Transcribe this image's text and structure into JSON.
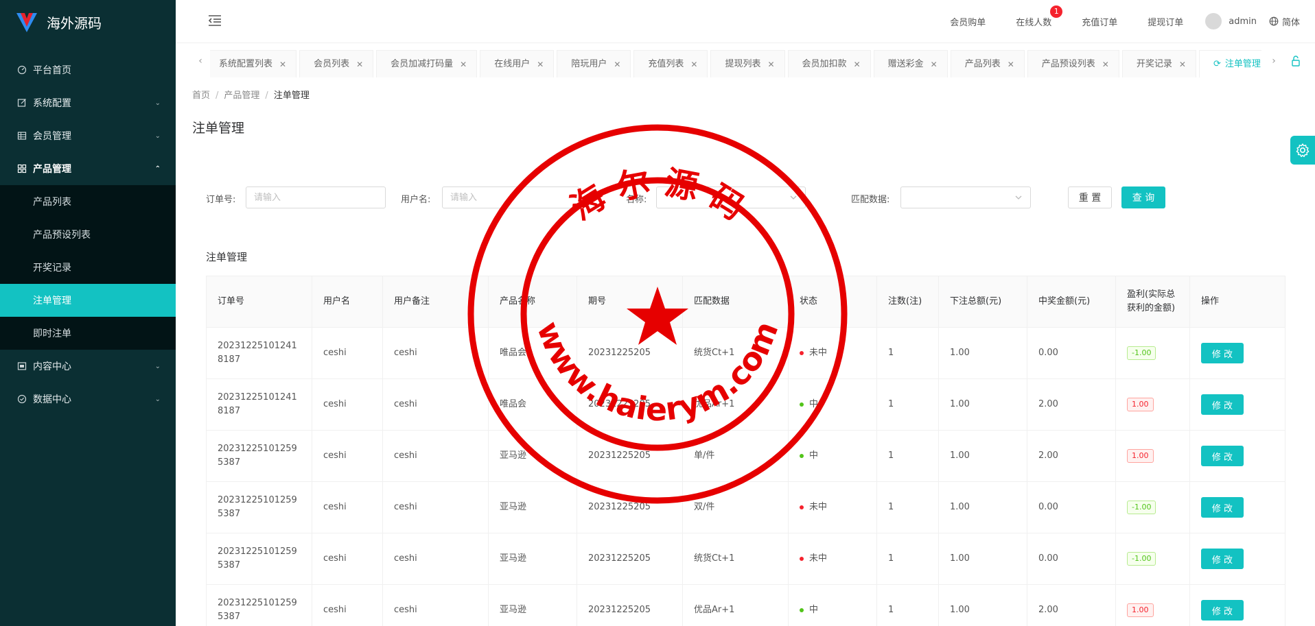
{
  "brand": {
    "name": "海外源码",
    "logo": "v-logo"
  },
  "menu": {
    "items": [
      {
        "label": "平台首页",
        "icon": "dashboard-icon"
      },
      {
        "label": "系统配置",
        "icon": "edit-icon"
      },
      {
        "label": "会员管理",
        "icon": "table-icon"
      },
      {
        "label": "产品管理",
        "icon": "grid-icon"
      },
      {
        "label": "内容中心",
        "icon": "content-icon"
      },
      {
        "label": "数据中心",
        "icon": "check-circle-icon"
      }
    ],
    "sub": [
      {
        "label": "产品列表"
      },
      {
        "label": "产品预设列表"
      },
      {
        "label": "开奖记录"
      },
      {
        "label": "注单管理"
      },
      {
        "label": "即时注单"
      }
    ]
  },
  "header": {
    "links": [
      {
        "label": "会员购单"
      },
      {
        "label": "在线人数",
        "badge": "1"
      },
      {
        "label": "充值订单"
      },
      {
        "label": "提现订单"
      }
    ],
    "user": "admin",
    "lang": "简体"
  },
  "tabs": [
    {
      "label": "系统配置列表"
    },
    {
      "label": "会员列表"
    },
    {
      "label": "会员加减打码量"
    },
    {
      "label": "在线用户"
    },
    {
      "label": "陪玩用户"
    },
    {
      "label": "充值列表"
    },
    {
      "label": "提现列表"
    },
    {
      "label": "会员加扣款"
    },
    {
      "label": "赠送彩金"
    },
    {
      "label": "产品列表"
    },
    {
      "label": "产品预设列表"
    },
    {
      "label": "开奖记录"
    },
    {
      "label": "注单管理"
    }
  ],
  "breadcrumb": {
    "home": "首页",
    "parent": "产品管理",
    "current": "注单管理"
  },
  "page_title": "注单管理",
  "filters": {
    "order_label": "订单号:",
    "order_placeholder": "请输入",
    "user_label": "用户名:",
    "user_placeholder": "请输入",
    "name_label": "名称:",
    "match_label": "匹配数据:",
    "reset": "重 置",
    "query": "查 询"
  },
  "table_title": "注单管理",
  "columns": [
    "订单号",
    "用户名",
    "用户备注",
    "产品名称",
    "期号",
    "匹配数据",
    "状态",
    "注数(注)",
    "下注总额(元)",
    "中奖金额(元)",
    "盈利(实际总获利的金额)",
    "操作"
  ],
  "rows": [
    {
      "order": "202312251012418187",
      "user": "ceshi",
      "remark": "ceshi",
      "product": "唯品会",
      "period": "20231225205",
      "match": "统货Ct+1",
      "status": "未中",
      "status_color": "#f5222d",
      "count": "1",
      "total": "1.00",
      "win": "0.00",
      "profit": "-1.00",
      "profit_type": "loss",
      "action": "修 改"
    },
    {
      "order": "202312251012418187",
      "user": "ceshi",
      "remark": "ceshi",
      "product": "唯品会",
      "period": "20231225205",
      "match": "优品Ar+1",
      "status": "中",
      "status_color": "#52c41a",
      "count": "1",
      "total": "1.00",
      "win": "2.00",
      "profit": "1.00",
      "profit_type": "win",
      "action": "修 改"
    },
    {
      "order": "202312251012595387",
      "user": "ceshi",
      "remark": "ceshi",
      "product": "亚马逊",
      "period": "20231225205",
      "match": "单/件",
      "status": "中",
      "status_color": "#52c41a",
      "count": "1",
      "total": "1.00",
      "win": "2.00",
      "profit": "1.00",
      "profit_type": "win",
      "action": "修 改"
    },
    {
      "order": "202312251012595387",
      "user": "ceshi",
      "remark": "ceshi",
      "product": "亚马逊",
      "period": "20231225205",
      "match": "双/件",
      "status": "未中",
      "status_color": "#f5222d",
      "count": "1",
      "total": "1.00",
      "win": "0.00",
      "profit": "-1.00",
      "profit_type": "loss",
      "action": "修 改"
    },
    {
      "order": "202312251012595387",
      "user": "ceshi",
      "remark": "ceshi",
      "product": "亚马逊",
      "period": "20231225205",
      "match": "统货Ct+1",
      "status": "未中",
      "status_color": "#f5222d",
      "count": "1",
      "total": "1.00",
      "win": "0.00",
      "profit": "-1.00",
      "profit_type": "loss",
      "action": "修 改"
    },
    {
      "order": "202312251012595387",
      "user": "ceshi",
      "remark": "ceshi",
      "product": "亚马逊",
      "period": "20231225205",
      "match": "优品Ar+1",
      "status": "中",
      "status_color": "#52c41a",
      "count": "1",
      "total": "1.00",
      "win": "2.00",
      "profit": "1.00",
      "profit_type": "win",
      "action": "修 改"
    }
  ],
  "watermark": {
    "top_text": "海 尔 源 码",
    "bottom_text": "www.haierym.com",
    "color": "#e60000"
  },
  "colors": {
    "accent": "#13c2c2",
    "sidebar": "#0b2f33",
    "sidebar_sub": "#021416"
  }
}
